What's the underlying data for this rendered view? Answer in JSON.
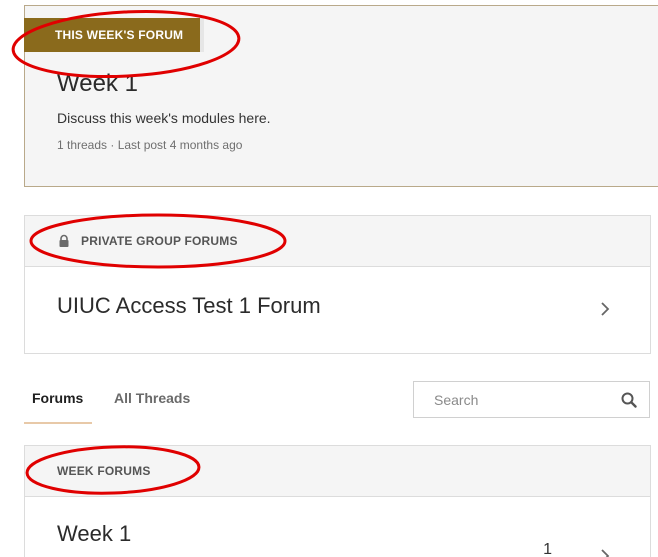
{
  "this_week": {
    "tag": "THIS WEEK'S FORUM",
    "title": "Week 1",
    "description": "Discuss this week's modules here.",
    "meta": "1 threads · Last post 4 months ago"
  },
  "private_group": {
    "header": "PRIVATE GROUP FORUMS",
    "icon": "lock-icon",
    "forum_title": "UIUC Access Test 1 Forum"
  },
  "tabs": {
    "forums": "Forums",
    "all_threads": "All Threads"
  },
  "search": {
    "placeholder": "Search",
    "icon": "search-icon"
  },
  "week_forums": {
    "header": "WEEK FORUMS",
    "items": [
      {
        "title": "Week 1",
        "count": "1"
      }
    ]
  },
  "colors": {
    "tag_bg": "#8a6a1c",
    "annotation": "#e00000",
    "tab_underline": "#e8c9a8"
  }
}
